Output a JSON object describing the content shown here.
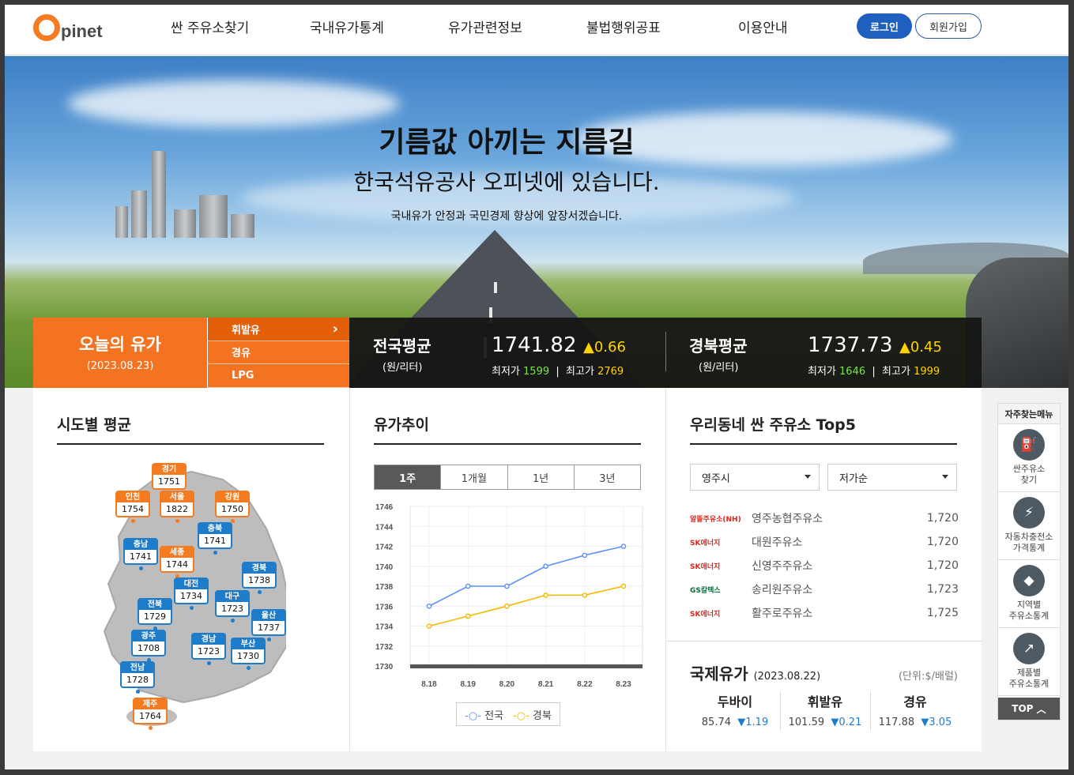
{
  "header": {
    "logo": "pinet",
    "nav": [
      "싼 주유소찾기",
      "국내유가통계",
      "유가관련정보",
      "불법행위공표",
      "이용안내"
    ],
    "login": "로그인",
    "join": "회원가입"
  },
  "hero": {
    "title": "기름값 아끼는 지름길",
    "subtitle": "한국석유공사 오피넷에 있습니다.",
    "note": "국내유가 안정과 국민경제 향상에 앞장서겠습니다."
  },
  "today": {
    "title": "오늘의 유가",
    "date": "(2023.08.23)",
    "fuel_tabs": [
      "휘발유",
      "경유",
      "LPG"
    ],
    "national": {
      "name": "전국평균",
      "unit": "(원/리터)",
      "price": "1741.82",
      "change": "▲0.66",
      "min_label": "최저가",
      "min": "1599",
      "max_label": "최고가",
      "max": "2769"
    },
    "regional": {
      "name": "경북평균",
      "unit": "(원/리터)",
      "price": "1737.73",
      "change": "▲0.45",
      "min_label": "최저가",
      "min": "1646",
      "max_label": "최고가",
      "max": "1999"
    }
  },
  "sido": {
    "title": "시도별 평균",
    "regions": [
      {
        "name": "경기",
        "value": "1751",
        "color": "orange"
      },
      {
        "name": "인천",
        "value": "1754",
        "color": "orange"
      },
      {
        "name": "서울",
        "value": "1822",
        "color": "orange"
      },
      {
        "name": "강원",
        "value": "1750",
        "color": "orange"
      },
      {
        "name": "충북",
        "value": "1741",
        "color": "blue"
      },
      {
        "name": "충남",
        "value": "1741",
        "color": "blue"
      },
      {
        "name": "세종",
        "value": "1744",
        "color": "orange"
      },
      {
        "name": "경북",
        "value": "1738",
        "color": "blue"
      },
      {
        "name": "대전",
        "value": "1734",
        "color": "blue"
      },
      {
        "name": "전북",
        "value": "1729",
        "color": "blue"
      },
      {
        "name": "대구",
        "value": "1723",
        "color": "blue"
      },
      {
        "name": "울산",
        "value": "1737",
        "color": "blue"
      },
      {
        "name": "광주",
        "value": "1708",
        "color": "blue"
      },
      {
        "name": "경남",
        "value": "1723",
        "color": "blue"
      },
      {
        "name": "부산",
        "value": "1730",
        "color": "blue"
      },
      {
        "name": "전남",
        "value": "1728",
        "color": "blue"
      },
      {
        "name": "제주",
        "value": "1764",
        "color": "orange"
      }
    ]
  },
  "trend": {
    "title": "유가추이",
    "periods": [
      "1주",
      "1개월",
      "1년",
      "3년"
    ],
    "active_period": "1주"
  },
  "chart_data": {
    "type": "line",
    "categories": [
      "8.18",
      "8.19",
      "8.20",
      "8.21",
      "8.22",
      "8.23"
    ],
    "series": [
      {
        "name": "전국",
        "values": [
          1736.0,
          1738.0,
          1738.0,
          1740.0,
          1741.1,
          1742.0
        ],
        "color": "#5b8ff9"
      },
      {
        "name": "경북",
        "values": [
          1734.0,
          1735.0,
          1736.0,
          1737.1,
          1737.1,
          1738.0
        ],
        "color": "#f5b800"
      }
    ],
    "yticks": [
      "1746",
      "1744",
      "1742",
      "1740",
      "1738",
      "1736",
      "1734",
      "1732",
      "1730"
    ],
    "ylim": [
      1730,
      1746
    ],
    "grid": true,
    "legend": "bottom"
  },
  "top5": {
    "title": "우리동네 싼 주유소 Top5",
    "region_select": "영주시",
    "sort_select": "저가순",
    "stations": [
      {
        "brand": "알뜰주유소(NH)",
        "name": "영주농협주유소",
        "price": "1,720"
      },
      {
        "brand": "SK에너지",
        "name": "대원주유소",
        "price": "1,720"
      },
      {
        "brand": "SK에너지",
        "name": "신영주주유소",
        "price": "1,720"
      },
      {
        "brand": "GS칼텍스",
        "name": "송리원주유소",
        "price": "1,723"
      },
      {
        "brand": "SK에너지",
        "name": "활주로주유소",
        "price": "1,725"
      }
    ]
  },
  "intl": {
    "title": "국제유가",
    "date": "(2023.08.22)",
    "unit": "(단위:$/배럴)",
    "items": [
      {
        "name": "두바이",
        "price": "85.74",
        "change": "▼1.19"
      },
      {
        "name": "휘발유",
        "price": "101.59",
        "change": "▼0.21"
      },
      {
        "name": "경유",
        "price": "117.88",
        "change": "▼3.05"
      }
    ]
  },
  "quick": {
    "title": "자주찾는메뉴",
    "items": [
      {
        "label1": "싼주유소",
        "label2": "찾기"
      },
      {
        "label1": "자동차충전소",
        "label2": "가격통계"
      },
      {
        "label1": "지역별",
        "label2": "주유소통계"
      },
      {
        "label1": "제품별",
        "label2": "주유소통계"
      }
    ],
    "top": "TOP"
  }
}
